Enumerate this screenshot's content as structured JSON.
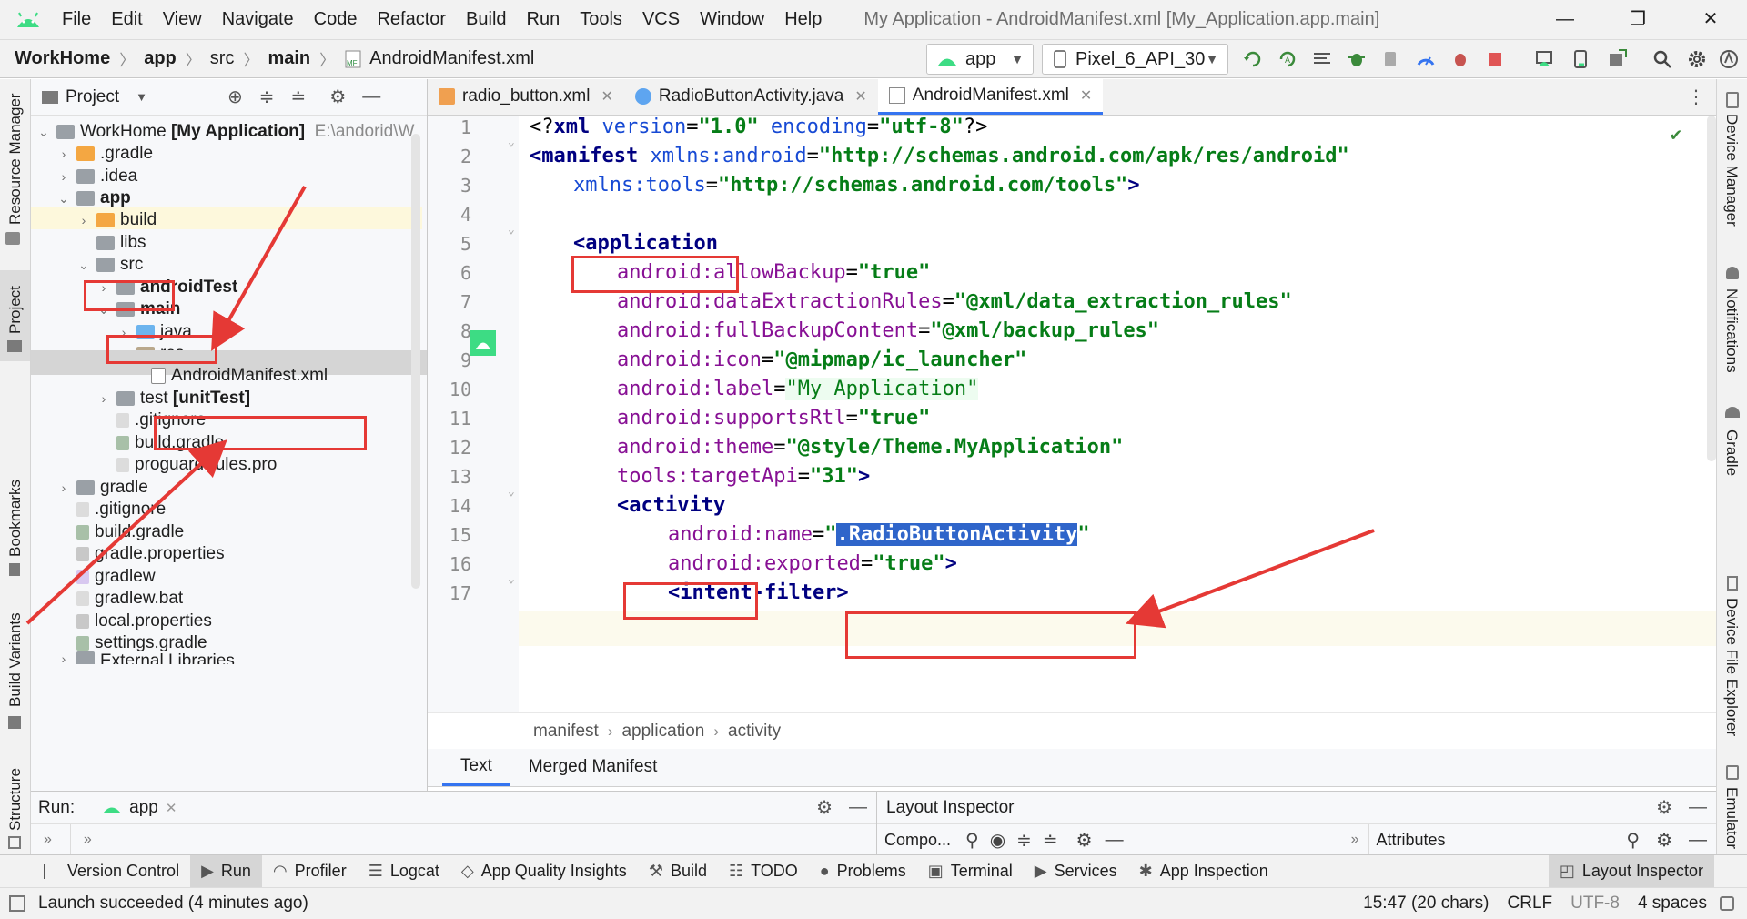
{
  "menubar": {
    "items": [
      "File",
      "Edit",
      "View",
      "Navigate",
      "Code",
      "Refactor",
      "Build",
      "Run",
      "Tools",
      "VCS",
      "Window",
      "Help"
    ],
    "window_title": "My Application - AndroidManifest.xml [My_Application.app.main]",
    "minimize": "—",
    "restore": "❐",
    "close": "✕"
  },
  "navbar": {
    "crumbs": [
      "WorkHome",
      "app",
      "src",
      "main",
      "AndroidManifest.xml"
    ],
    "run_config": "app",
    "device": "Pixel_6_API_30"
  },
  "left_stripe": {
    "resource_manager": "Resource Manager",
    "project": "Project",
    "bookmarks": "Bookmarks",
    "build_variants": "Build Variants",
    "structure": "Structure"
  },
  "right_stripe": {
    "device_manager": "Device Manager",
    "notifications": "Notifications",
    "gradle": "Gradle",
    "device_file_explorer": "Device File Explorer",
    "emulator": "Emulator"
  },
  "project_panel": {
    "header": "Project",
    "root_name": "WorkHome",
    "root_module": "[My Application]",
    "root_path": "E:\\andorid\\W",
    "items": [
      {
        "label": ".gradle",
        "bold": false
      },
      {
        "label": ".idea",
        "bold": false
      },
      {
        "label": "app",
        "bold": true
      },
      {
        "label": "build",
        "bold": false
      },
      {
        "label": "libs",
        "bold": false
      },
      {
        "label": "src",
        "bold": false
      },
      {
        "label": "androidTest",
        "bold": true
      },
      {
        "label": "main",
        "bold": true
      },
      {
        "label": "java",
        "bold": false
      },
      {
        "label": "res",
        "bold": false
      },
      {
        "label": "AndroidManifest.xml",
        "bold": false
      },
      {
        "label": "test",
        "bold": false
      },
      {
        "label": ".gitignore",
        "bold": false
      },
      {
        "label": "build.gradle",
        "bold": false
      },
      {
        "label": "proguard-rules.pro",
        "bold": false
      },
      {
        "label": "gradle",
        "bold": false
      },
      {
        "label": ".gitignore",
        "bold": false
      },
      {
        "label": "build.gradle",
        "bold": false
      },
      {
        "label": "gradle.properties",
        "bold": false
      },
      {
        "label": "gradlew",
        "bold": false
      },
      {
        "label": "gradlew.bat",
        "bold": false
      },
      {
        "label": "local.properties",
        "bold": false
      },
      {
        "label": "settings.gradle",
        "bold": false
      },
      {
        "label": "External Libraries",
        "bold": false
      }
    ],
    "test_suffix": "[unitTest]"
  },
  "editor_tabs": [
    {
      "label": "radio_button.xml",
      "active": false
    },
    {
      "label": "RadioButtonActivity.java",
      "active": false
    },
    {
      "label": "AndroidManifest.xml",
      "active": true
    }
  ],
  "code": {
    "line_numbers": [
      "1",
      "2",
      "3",
      "4",
      "5",
      "6",
      "7",
      "8",
      "9",
      "10",
      "11",
      "12",
      "13",
      "14",
      "15",
      "16",
      "17"
    ],
    "l1": {
      "a": "<?",
      "b": "xml ",
      "c": "version",
      "d": "=",
      "e": "\"1.0\"",
      "f": " encoding",
      "g": "=",
      "h": "\"utf-8\"",
      "i": "?>"
    },
    "l2": {
      "a": "<manifest ",
      "b": "xmlns:",
      "c": "android",
      "d": "=",
      "e": "\"http://schemas.android.com/apk/res/android\""
    },
    "l3": {
      "a": "xmlns:",
      "b": "tools",
      "c": "=",
      "d": "\"http://schemas.android.com/tools\"",
      "e": ">"
    },
    "l5": {
      "a": "<application"
    },
    "l6": {
      "ns": "android:",
      "attr": "allowBackup",
      "eq": "=",
      "val": "\"true\""
    },
    "l7": {
      "ns": "android:",
      "attr": "dataExtractionRules",
      "eq": "=",
      "val": "\"@xml/data_extraction_rules\""
    },
    "l8": {
      "ns": "android:",
      "attr": "fullBackupContent",
      "eq": "=",
      "val": "\"@xml/backup_rules\""
    },
    "l9": {
      "ns": "android:",
      "attr": "icon",
      "eq": "=",
      "val": "\"@mipmap/ic_launcher\""
    },
    "l10": {
      "ns": "android:",
      "attr": "label",
      "eq": "=",
      "val": "\"My Application\""
    },
    "l11": {
      "ns": "android:",
      "attr": "supportsRtl",
      "eq": "=",
      "val": "\"true\""
    },
    "l12": {
      "ns": "android:",
      "attr": "theme",
      "eq": "=",
      "val": "\"@style/Theme.MyApplication\""
    },
    "l13": {
      "ns": "tools:",
      "attr": "targetApi",
      "eq": "=",
      "val": "\"31\"",
      "end": ">"
    },
    "l14": {
      "a": "<activity"
    },
    "l15": {
      "ns": "android:",
      "attr": "name",
      "eq": "=",
      "q1": "\"",
      "sel": ".RadioButtonActivity",
      "q2": "\""
    },
    "l16": {
      "ns": "android:",
      "attr": "exported",
      "eq": "=",
      "val": "\"true\"",
      "end": ">"
    },
    "l17": {
      "a": "<intent-filter>"
    }
  },
  "editor_breadcrumb": [
    "manifest",
    "application",
    "activity"
  ],
  "editor_bottom_tabs": [
    "Text",
    "Merged Manifest"
  ],
  "run_panel": {
    "label": "Run:",
    "config": "app"
  },
  "layout_inspector": {
    "title": "Layout Inspector",
    "component": "Compo...",
    "attributes": "Attributes"
  },
  "tool_windows": [
    "Version Control",
    "Run",
    "Profiler",
    "Logcat",
    "App Quality Insights",
    "Build",
    "TODO",
    "Problems",
    "Terminal",
    "Services",
    "App Inspection",
    "Layout Inspector"
  ],
  "status": {
    "message": "Launch succeeded (4 minutes ago)",
    "position": "15:47 (20 chars)",
    "line_sep": "CRLF",
    "encoding": "UTF-8",
    "indent": "4 spaces"
  },
  "colors": {
    "accent": "#3574f0",
    "annotation": "#e53935",
    "selection": "#2f65ca"
  }
}
